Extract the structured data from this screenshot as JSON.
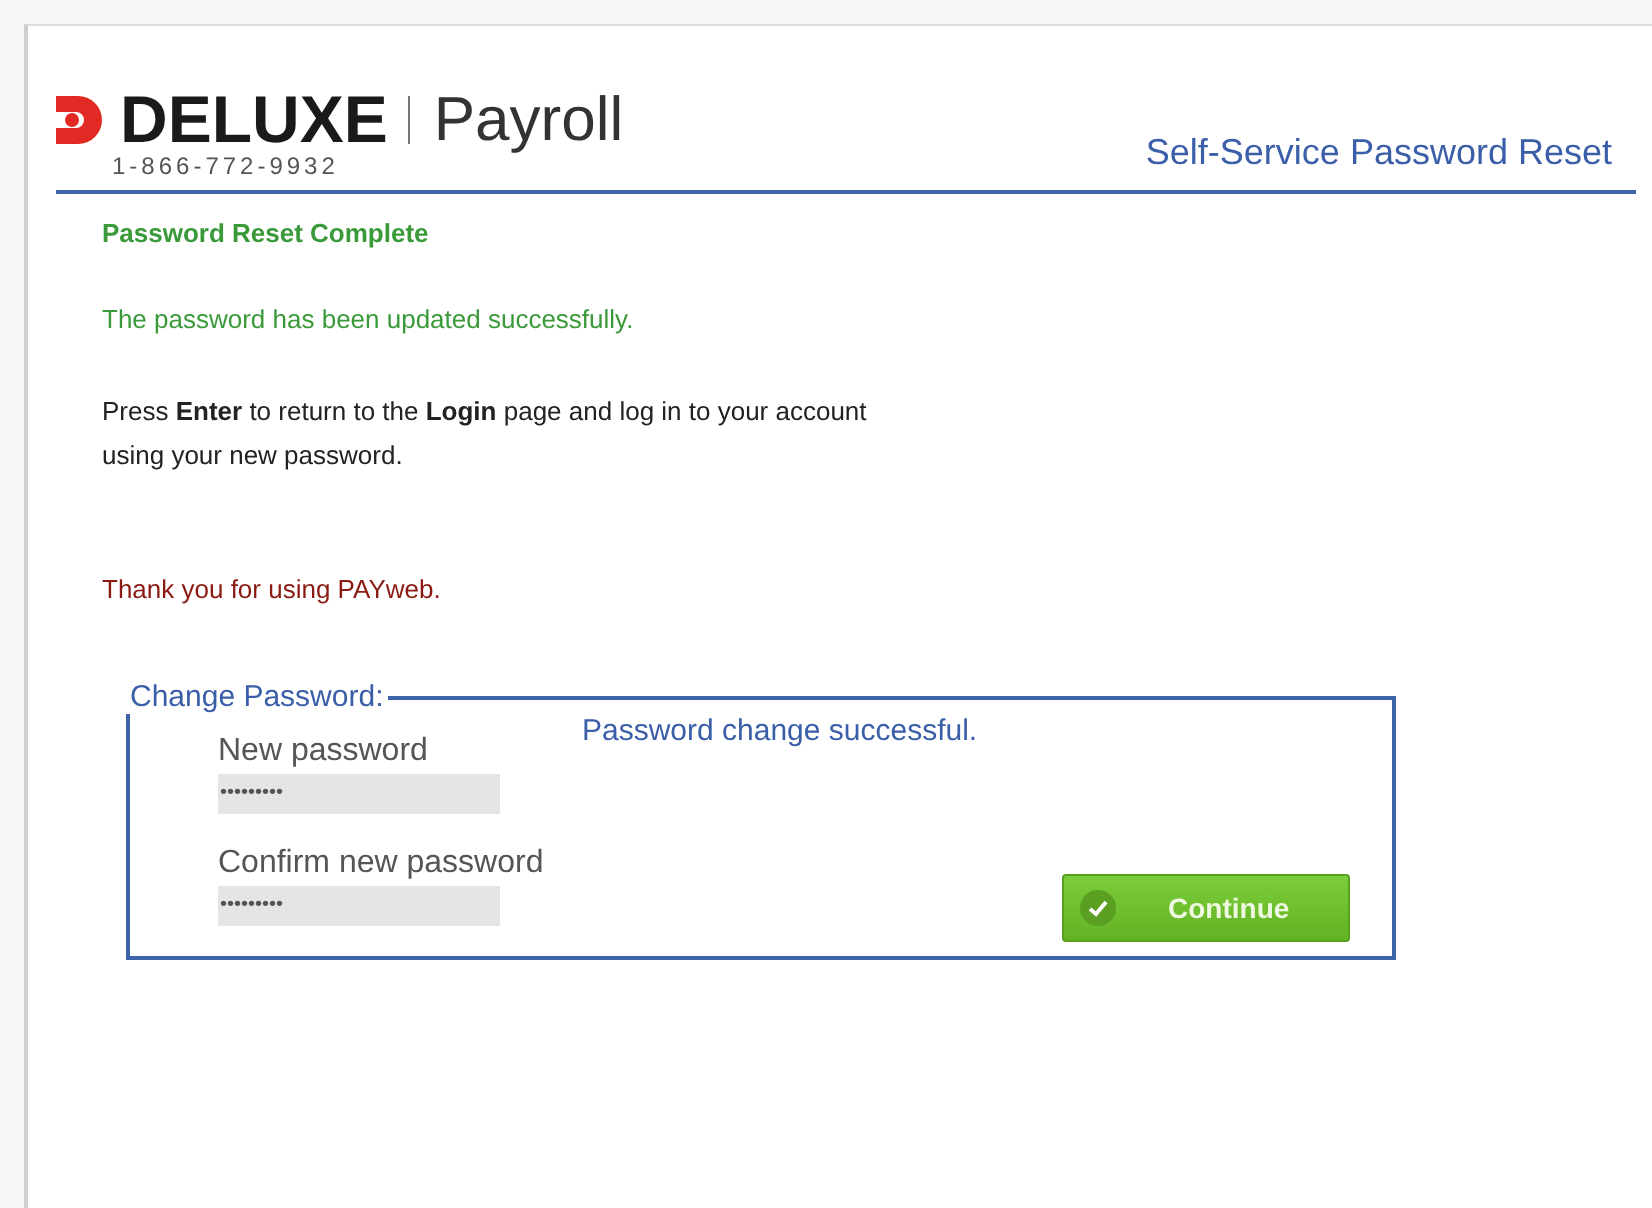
{
  "header": {
    "brand": "DELUXE",
    "product": "Payroll",
    "phone": "1-866-772-9932",
    "page_title": "Self-Service Password Reset"
  },
  "content": {
    "heading": "Password Reset Complete",
    "success": "The password has been updated successfully.",
    "instructions": "Press **Enter** to return to the **Login** page and log in to your account using your new password.",
    "thanks": "Thank you for using PAYweb."
  },
  "form": {
    "legend": "Change Password:",
    "status": "Password change successful.",
    "fields": [
      {
        "label": "New password",
        "value": "•••••••••"
      },
      {
        "label": "Confirm new password",
        "value": "•••••••••"
      }
    ],
    "button": "Continue"
  }
}
